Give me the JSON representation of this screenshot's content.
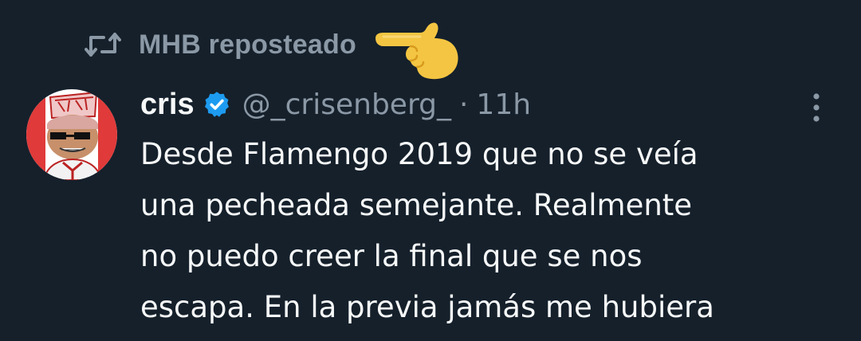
{
  "repost": {
    "icon": "repost-icon",
    "label": "MHB reposteado",
    "emoji": "backhand-index-pointing-right-emoji"
  },
  "tweet": {
    "author": {
      "name": "cris",
      "handle": "@_crisenberg_",
      "verified": true,
      "avatar": "avatar-cartoon"
    },
    "separator": "·",
    "time": "11h",
    "more_icon": "more-vertical-icon",
    "text_lines": [
      "Desde Flamengo 2019 que no se veía",
      "una pecheada semejante. Realmente",
      "no puedo creer la final que se nos",
      "escapa. En la previa jamás me hubiera"
    ]
  },
  "colors": {
    "background": "#15202b",
    "text_primary": "#f7f9f9",
    "text_secondary": "#8b98a5",
    "verified_blue": "#1d9bf0"
  }
}
